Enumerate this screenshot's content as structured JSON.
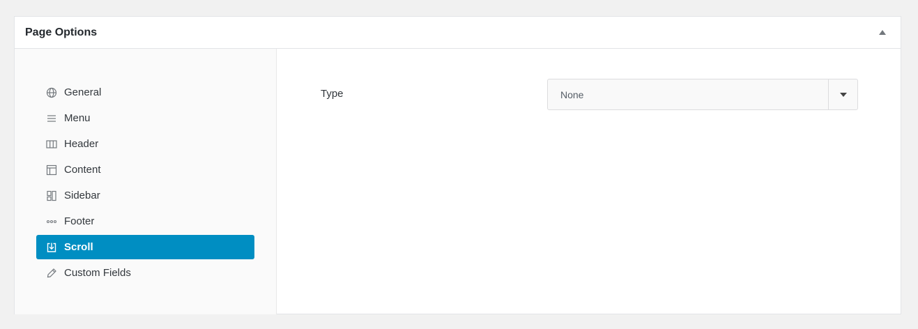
{
  "panel": {
    "title": "Page Options",
    "toggle_icon": "triangle-up-icon"
  },
  "sidebar": {
    "items": [
      {
        "label": "General",
        "icon": "globe-icon",
        "active": false
      },
      {
        "label": "Menu",
        "icon": "menu-icon",
        "active": false
      },
      {
        "label": "Header",
        "icon": "columns-icon",
        "active": false
      },
      {
        "label": "Content",
        "icon": "layout-icon",
        "active": false
      },
      {
        "label": "Sidebar",
        "icon": "sidebar-icon",
        "active": false
      },
      {
        "label": "Footer",
        "icon": "dots-icon",
        "active": false
      },
      {
        "label": "Scroll",
        "icon": "download-box-icon",
        "active": true
      },
      {
        "label": "Custom Fields",
        "icon": "pencil-icon",
        "active": false
      }
    ]
  },
  "content": {
    "type_label": "Type",
    "type_select": {
      "value": "None",
      "arrow_icon": "caret-down-icon"
    }
  },
  "colors": {
    "accent": "#008ec2",
    "background": "#f1f1f1"
  }
}
